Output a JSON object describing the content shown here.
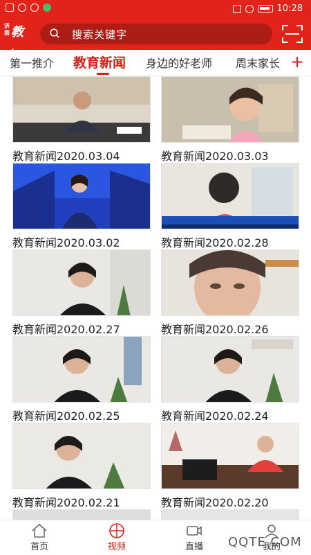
{
  "status_bar": {
    "time": "10:28"
  },
  "header": {
    "logo_text": "教育",
    "logo_small": "济南",
    "search_placeholder": "搜索关键字"
  },
  "tabs": [
    {
      "label": "第一推介"
    },
    {
      "label": "教育新闻"
    },
    {
      "label": "身边的好老师"
    },
    {
      "label": "周末家长"
    }
  ],
  "tab_more": "+",
  "videos": [
    {
      "title": "教育新闻2020.03.04"
    },
    {
      "title": "教育新闻2020.03.03"
    },
    {
      "title": "教育新闻2020.03.02"
    },
    {
      "title": "教育新闻2020.02.28"
    },
    {
      "title": "教育新闻2020.02.27"
    },
    {
      "title": "教育新闻2020.02.26"
    },
    {
      "title": "教育新闻2020.02.25"
    },
    {
      "title": "教育新闻2020.02.24"
    },
    {
      "title": "教育新闻2020.02.21"
    },
    {
      "title": "教育新闻2020.02.20"
    }
  ],
  "bottom_nav": [
    {
      "label": "首页",
      "icon": "home-icon"
    },
    {
      "label": "视频",
      "icon": "video-play-icon"
    },
    {
      "label": "直播",
      "icon": "camera-icon"
    },
    {
      "label": "我的",
      "icon": "user-icon"
    }
  ],
  "watermark": "QQTE.COM",
  "colors": {
    "brand_red": "#e2231a",
    "search_bg": "#ad1c15",
    "active_tab": "#d2231a"
  }
}
